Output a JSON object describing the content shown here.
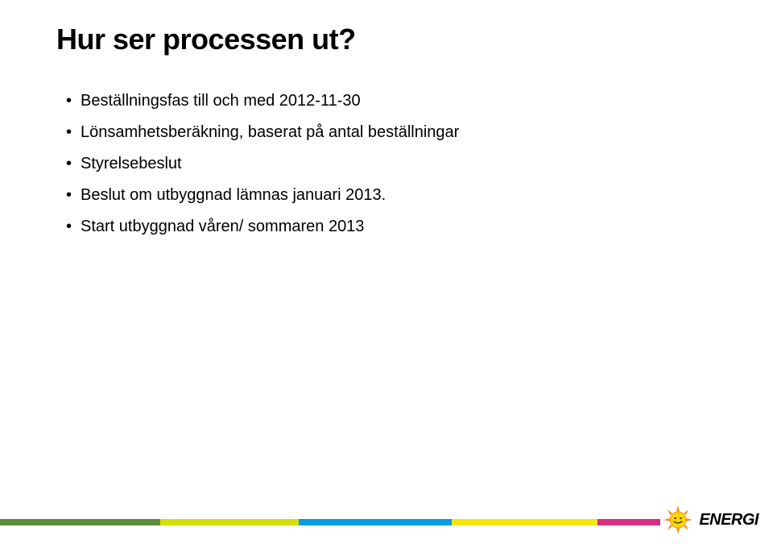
{
  "title": "Hur ser processen ut?",
  "bullets": [
    "Beställningsfas till och med 2012-11-30",
    "Lönsamhetsberäkning, baserat på antal beställningar",
    "Styrelsebeslut",
    "Beslut om utbyggnad lämnas januari 2013.",
    "Start utbyggnad våren/ sommaren 2013"
  ],
  "logo": {
    "text": "ENERGI"
  }
}
